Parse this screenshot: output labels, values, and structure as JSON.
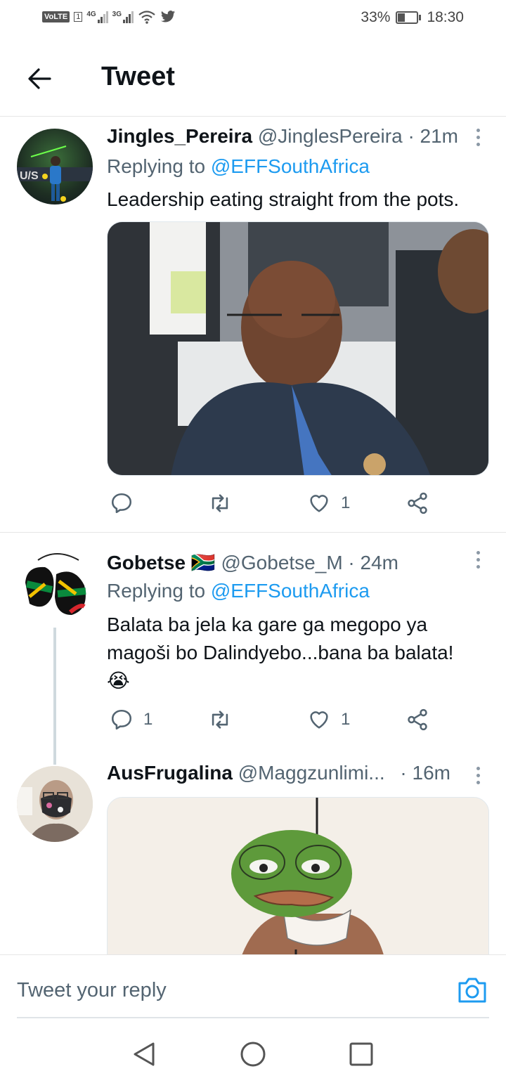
{
  "status_bar": {
    "volte": "VoLTE",
    "sim_number": "1",
    "sim1_network": "4G",
    "sim2_network": "3G",
    "battery": "33%",
    "time": "18:30",
    "icons": [
      "wifi-icon",
      "twitter-bird-icon",
      "battery-icon"
    ]
  },
  "header": {
    "title": "Tweet",
    "back_icon": "arrow-left-icon"
  },
  "tweets": [
    {
      "name": "Jingles_Pereira",
      "handle": "@JinglesPereira",
      "time": "· 21m",
      "replying_prefix": "Replying to ",
      "replying_handle": "@EFFSouthAfrica",
      "text": "Leadership eating straight from the pots.",
      "has_media": true,
      "reply_count": "",
      "retweet_count": "",
      "like_count": "1"
    },
    {
      "name": "Gobetse",
      "flag_emoji": "🇿🇦",
      "handle": "@Gobetse_M",
      "time": "· 24m",
      "replying_prefix": "Replying to ",
      "replying_handle": "@EFFSouthAfrica",
      "text_line1": "Balata ba jela ka gare ga megopo ya",
      "text_line2": "magoši bo Dalindyebo...bana ba balata!",
      "text_emoji": "😭",
      "reply_count": "1",
      "retweet_count": "",
      "like_count": "1"
    },
    {
      "name": "AusFrugalina",
      "handle": "@Maggzunlimi...",
      "time": "· 16m",
      "has_media": true
    }
  ],
  "reply_bar": {
    "placeholder": "Tweet your reply",
    "camera_icon": "camera-icon"
  },
  "nav_bar": {
    "icons": [
      "back-triangle-icon",
      "home-circle-icon",
      "recents-square-icon"
    ]
  },
  "colors": {
    "link": "#1d9bf0",
    "secondary_text": "#536471",
    "primary_text": "#0f1419"
  }
}
